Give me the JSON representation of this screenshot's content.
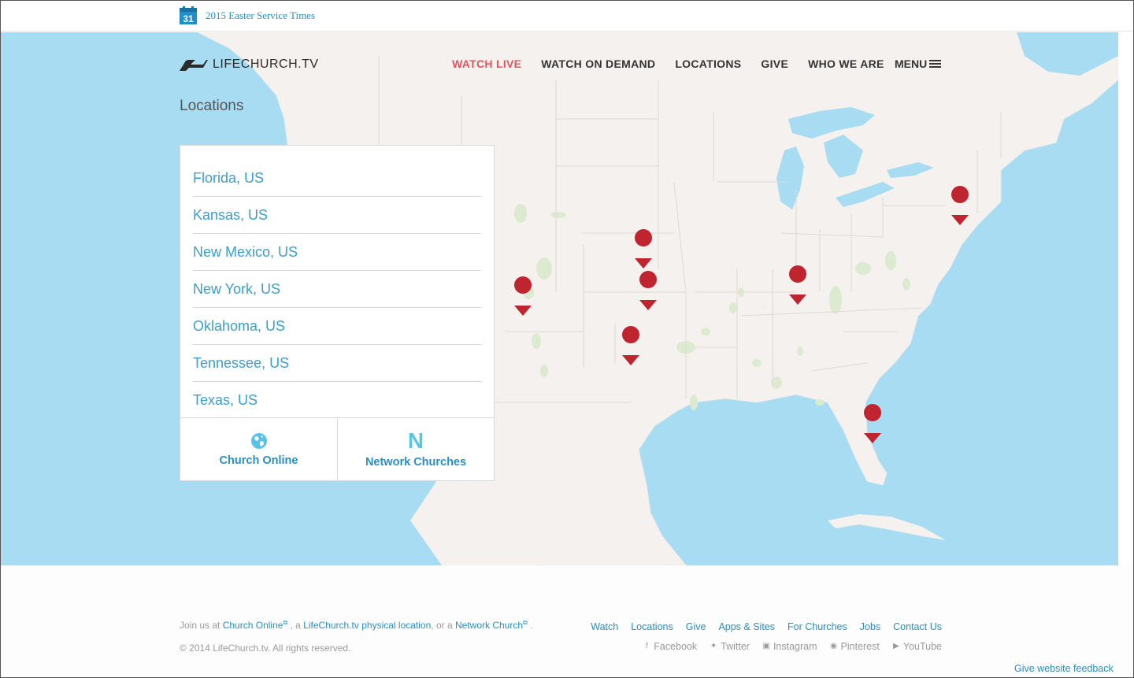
{
  "banner": {
    "calendar_day": "31",
    "link_text": "2015 Easter Service Times"
  },
  "header": {
    "logo_text": "LIFECHURCH.TV",
    "nav": [
      {
        "label": "WATCH LIVE",
        "highlight": true
      },
      {
        "label": "WATCH ON DEMAND"
      },
      {
        "label": "LOCATIONS"
      },
      {
        "label": "GIVE"
      },
      {
        "label": "WHO WE ARE"
      }
    ],
    "menu_label": "MENU"
  },
  "page_title": "Locations",
  "locations": [
    "Florida, US",
    "Kansas, US",
    "New Mexico, US",
    "New York, US",
    "Oklahoma, US",
    "Tennessee, US",
    "Texas, US"
  ],
  "panel_actions": [
    {
      "label": "Church Online",
      "icon": "globe-icon"
    },
    {
      "label": "Network Churches",
      "icon": "n-letter-icon"
    }
  ],
  "footer": {
    "join_prefix": "Join us at",
    "join_link1": "Church Online",
    "join_mid1": ", a",
    "join_link2": "LifeChurch.tv physical location",
    "join_mid2": ", or a",
    "join_link3": "Network Church",
    "join_suffix": ".",
    "copyright": "© 2014 LifeChurch.tv. All rights reserved.",
    "links": [
      "Watch",
      "Locations",
      "Give",
      "Apps & Sites",
      "For Churches",
      "Jobs",
      "Contact Us"
    ],
    "social": [
      {
        "label": "Facebook",
        "icon": "facebook-icon"
      },
      {
        "label": "Twitter",
        "icon": "twitter-icon"
      },
      {
        "label": "Instagram",
        "icon": "instagram-icon"
      },
      {
        "label": "Pinterest",
        "icon": "pinterest-icon"
      },
      {
        "label": "YouTube",
        "icon": "youtube-icon"
      }
    ],
    "feedback": "Give website feedback"
  },
  "colors": {
    "accent": "#2a8fc4",
    "live": "#e2545f",
    "marker": "#c0242f",
    "water": "#a7dcf2",
    "land": "#f4f1ee"
  }
}
